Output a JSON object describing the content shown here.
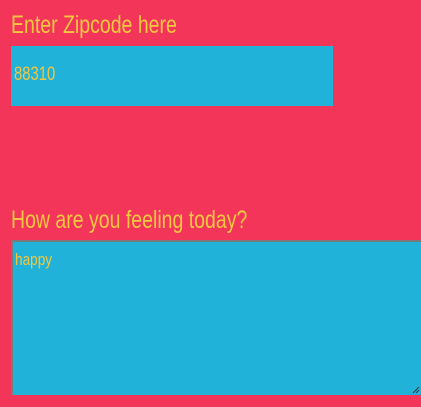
{
  "zipcode": {
    "label": "Enter Zipcode here",
    "value": "88310"
  },
  "feeling": {
    "label": "How are you feeling today?",
    "value": "happy"
  },
  "colors": {
    "background": "#f4355a",
    "field_fill": "#20b2d8",
    "text": "#f3c73f"
  }
}
